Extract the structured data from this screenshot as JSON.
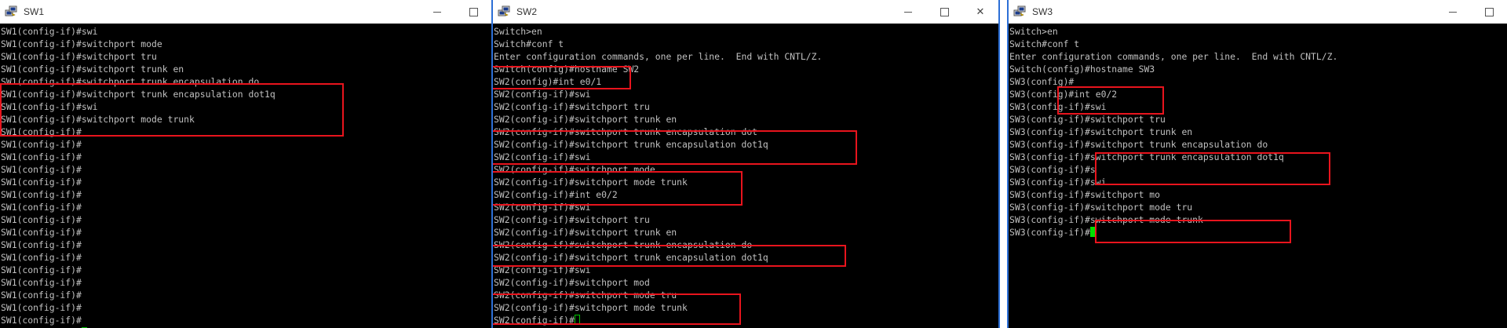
{
  "windows": [
    {
      "id": "sw1",
      "title": "SW1",
      "lines": [
        "SW1(config-if)#swi",
        "SW1(config-if)#switchport mode",
        "SW1(config-if)#switchport tru",
        "SW1(config-if)#switchport trunk en",
        "SW1(config-if)#switchport trunk encapsulation do",
        "SW1(config-if)#switchport trunk encapsulation dot1q",
        "SW1(config-if)#swi",
        "SW1(config-if)#switchport mode trunk",
        "SW1(config-if)#",
        "SW1(config-if)#",
        "SW1(config-if)#",
        "SW1(config-if)#",
        "SW1(config-if)#",
        "SW1(config-if)#",
        "SW1(config-if)#",
        "SW1(config-if)#",
        "SW1(config-if)#",
        "SW1(config-if)#",
        "SW1(config-if)#",
        "SW1(config-if)#",
        "SW1(config-if)#",
        "SW1(config-if)#",
        "SW1(config-if)#",
        "SW1(config-if)#",
        "SW1(config-if)#"
      ],
      "cursor": "hollow"
    },
    {
      "id": "sw2",
      "title": "SW2",
      "lines": [
        "Switch>en",
        "Switch#conf t",
        "Enter configuration commands, one per line.  End with CNTL/Z.",
        "Switch(config)#hostname SW2",
        "SW2(config)#int e0/1",
        "SW2(config-if)#swi",
        "SW2(config-if)#switchport tru",
        "SW2(config-if)#switchport trunk en",
        "SW2(config-if)#switchport trunk encapsulation dot",
        "SW2(config-if)#switchport trunk encapsulation dot1q",
        "SW2(config-if)#swi",
        "SW2(config-if)#switchport mode",
        "SW2(config-if)#switchport mode trunk",
        "SW2(config-if)#int e0/2",
        "SW2(config-if)#swi",
        "SW2(config-if)#switchport tru",
        "SW2(config-if)#switchport trunk en",
        "SW2(config-if)#switchport trunk encapsulation do",
        "SW2(config-if)#switchport trunk encapsulation dot1q",
        "SW2(config-if)#swi",
        "SW2(config-if)#switchport mod",
        "SW2(config-if)#switchport mode tru",
        "SW2(config-if)#switchport mode trunk",
        "SW2(config-if)#"
      ],
      "cursor": "hollow"
    },
    {
      "id": "sw3",
      "title": "SW3",
      "lines": [
        "Switch>en",
        "Switch#conf t",
        "Enter configuration commands, one per line.  End with CNTL/Z.",
        "Switch(config)#hostname SW3",
        "SW3(config)#",
        "SW3(config)#int e0/2",
        "SW3(config-if)#swi",
        "SW3(config-if)#switchport tru",
        "SW3(config-if)#switchport trunk en",
        "SW3(config-if)#switchport trunk encapsulation do",
        "SW3(config-if)#switchport trunk encapsulation dot1q",
        "SW3(config-if)#s",
        "SW3(config-if)#swi",
        "SW3(config-if)#switchport mo",
        "SW3(config-if)#switchport mode tru",
        "SW3(config-if)#switchport mode trunk",
        "SW3(config-if)#"
      ],
      "cursor": "solid"
    }
  ],
  "colors": {
    "terminal_bg": "#000000",
    "terminal_text": "#c0c0c0",
    "highlight_box": "#e8141d",
    "cursor": "#00e000",
    "active_border": "#2c6fd6"
  },
  "icons": {
    "app": "putty-icon",
    "minimize": "minimize-icon",
    "maximize": "maximize-icon",
    "close": "close-icon"
  },
  "controls": {
    "close_glyph": "✕"
  }
}
